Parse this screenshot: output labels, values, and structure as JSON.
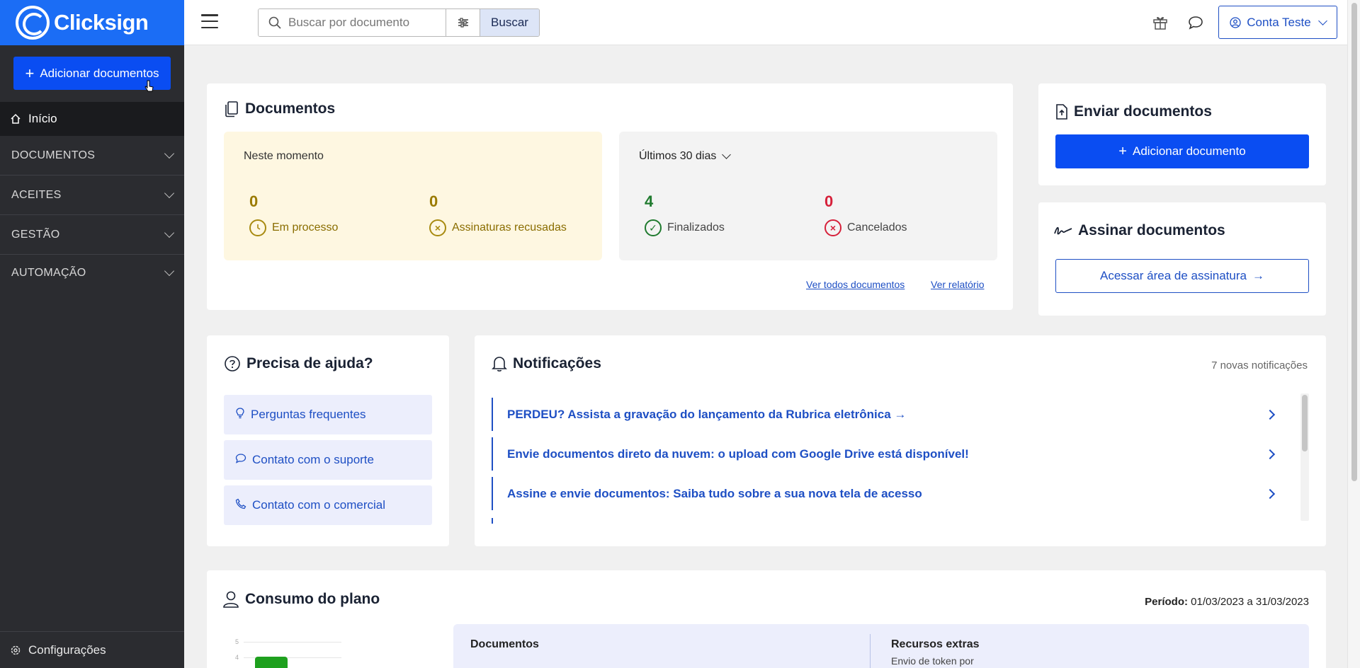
{
  "brand": {
    "name": "Clicksign"
  },
  "sidebar": {
    "add_button": "Adicionar documentos",
    "home": "Início",
    "sections": [
      {
        "label": "DOCUMENTOS"
      },
      {
        "label": "ACEITES"
      },
      {
        "label": "GESTÃO"
      },
      {
        "label": "AUTOMAÇÃO"
      }
    ],
    "config": "Configurações"
  },
  "topbar": {
    "search_placeholder": "Buscar por documento",
    "search_button": "Buscar",
    "account": "Conta Teste"
  },
  "documents_card": {
    "title": "Documentos",
    "now_label": "Neste momento",
    "in_process": {
      "count": "0",
      "label": "Em processo"
    },
    "refused": {
      "count": "0",
      "label": "Assinaturas recusadas"
    },
    "period_select": "Últimos 30 dias",
    "finished": {
      "count": "4",
      "label": "Finalizados"
    },
    "cancelled": {
      "count": "0",
      "label": "Cancelados"
    },
    "link_all": "Ver todos documentos",
    "link_report": "Ver relatório"
  },
  "send_card": {
    "title": "Enviar documentos",
    "button": "Adicionar documento"
  },
  "sign_card": {
    "title": "Assinar documentos",
    "button": "Acessar área de assinatura"
  },
  "help_card": {
    "title": "Precisa de ajuda?",
    "items": [
      {
        "label": "Perguntas frequentes"
      },
      {
        "label": "Contato com o suporte"
      },
      {
        "label": "Contato com o comercial"
      }
    ]
  },
  "notifications": {
    "title": "Notificações",
    "count_text": "7 novas notificações",
    "items": [
      {
        "text": "PERDEU? Assista a gravação do lançamento da Rubrica eletrônica →"
      },
      {
        "text": "Envie documentos direto da nuvem: o upload com Google Drive está disponível!"
      },
      {
        "text": "Assine e envie documentos: Saiba tudo sobre a sua nova tela de acesso"
      }
    ]
  },
  "plan": {
    "title": "Consumo do plano",
    "period_label": "Período:",
    "period_value": "01/03/2023 a 31/03/2023",
    "documents_label": "Documentos",
    "extras_label": "Recursos extras",
    "extras_sub": "Envio de token por",
    "chart_ticks": [
      "5",
      "4"
    ]
  },
  "colors": {
    "brand": "#1b6df5",
    "primary": "#0a4df2",
    "sidebar": "#2b2c30",
    "pending": "#8a6d00",
    "success": "#1f7a2e",
    "danger": "#d6203a"
  }
}
